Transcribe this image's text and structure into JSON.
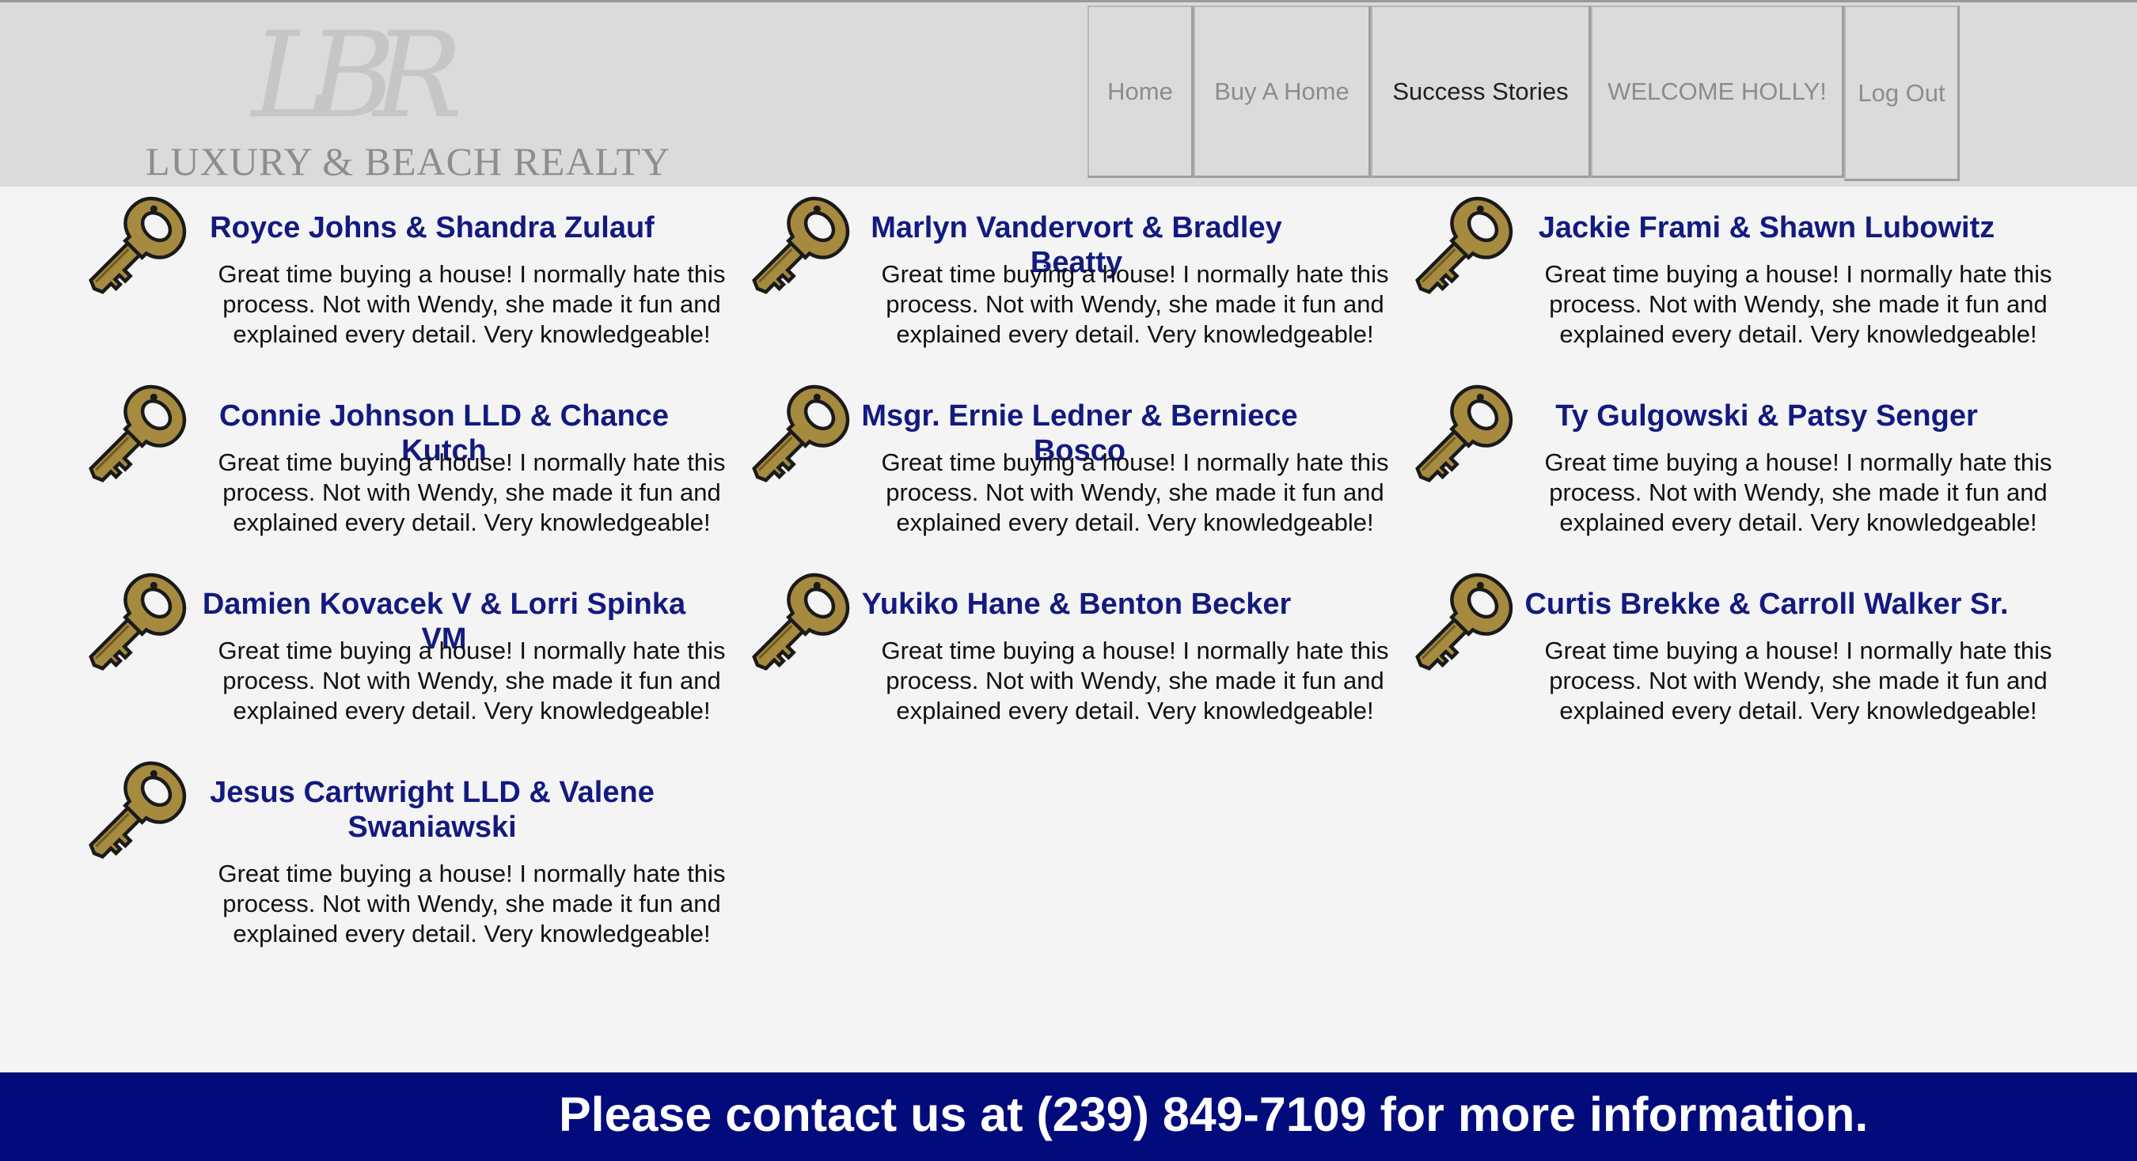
{
  "brand": {
    "monogram": "LBR",
    "name": "LUXURY & BEACH REALTY"
  },
  "nav": {
    "items": [
      {
        "label": "Home"
      },
      {
        "label": "Buy A Home"
      },
      {
        "label": "Success Stories",
        "active": true
      },
      {
        "label": "WELCOME HOLLY!"
      },
      {
        "label": "Log Out"
      }
    ]
  },
  "stories": [
    {
      "name": "Royce Johns & Shandra Zulauf",
      "text": "Great time buying a house! I normally hate this process. Not with Wendy, she made it fun and explained every detail. Very knowledgeable!"
    },
    {
      "name": "Marlyn Vandervort & Bradley Beatty",
      "text": "Great time buying a house! I normally hate this process. Not with Wendy, she made it fun and explained every detail. Very knowledgeable!"
    },
    {
      "name": "Jackie Frami & Shawn Lubowitz",
      "text": "Great time buying a house! I normally hate this process. Not with Wendy, she made it fun and explained every detail. Very knowledgeable!"
    },
    {
      "name": "Connie Johnson LLD & Chance Kutch",
      "text": "Great time buying a house! I normally hate this process. Not with Wendy, she made it fun and explained every detail. Very knowledgeable!"
    },
    {
      "name": "Msgr. Ernie Ledner & Berniece Bosco",
      "text": "Great time buying a house! I normally hate this process. Not with Wendy, she made it fun and explained every detail. Very knowledgeable!"
    },
    {
      "name": "Ty Gulgowski & Patsy Senger",
      "text": "Great time buying a house! I normally hate this process. Not with Wendy, she made it fun and explained every detail. Very knowledgeable!"
    },
    {
      "name": "Damien Kovacek V & Lorri Spinka VM",
      "text": "Great time buying a house! I normally hate this process. Not with Wendy, she made it fun and explained every detail. Very knowledgeable!"
    },
    {
      "name": "Yukiko Hane & Benton Becker",
      "text": "Great time buying a house! I normally hate this process. Not with Wendy, she made it fun and explained every detail. Very knowledgeable!"
    },
    {
      "name": "Curtis Brekke & Carroll Walker Sr.",
      "text": "Great time buying a house! I normally hate this process. Not with Wendy, she made it fun and explained every detail. Very knowledgeable!"
    },
    {
      "name": "Jesus Cartwright LLD & Valene Swaniawski",
      "text": "Great time buying a house! I normally hate this process. Not with Wendy, she made it fun and explained every detail. Very knowledgeable!"
    }
  ],
  "story_icon": "key-icon",
  "footer": {
    "contact": "Please contact us at (239) 849-7109 for more information."
  },
  "colors": {
    "header_bg": "#dcdbdb",
    "page_bg": "#f4f4f5",
    "name_color": "#131a7f",
    "footer_bg": "#020b7c",
    "key_gold": "#a58a3f"
  }
}
